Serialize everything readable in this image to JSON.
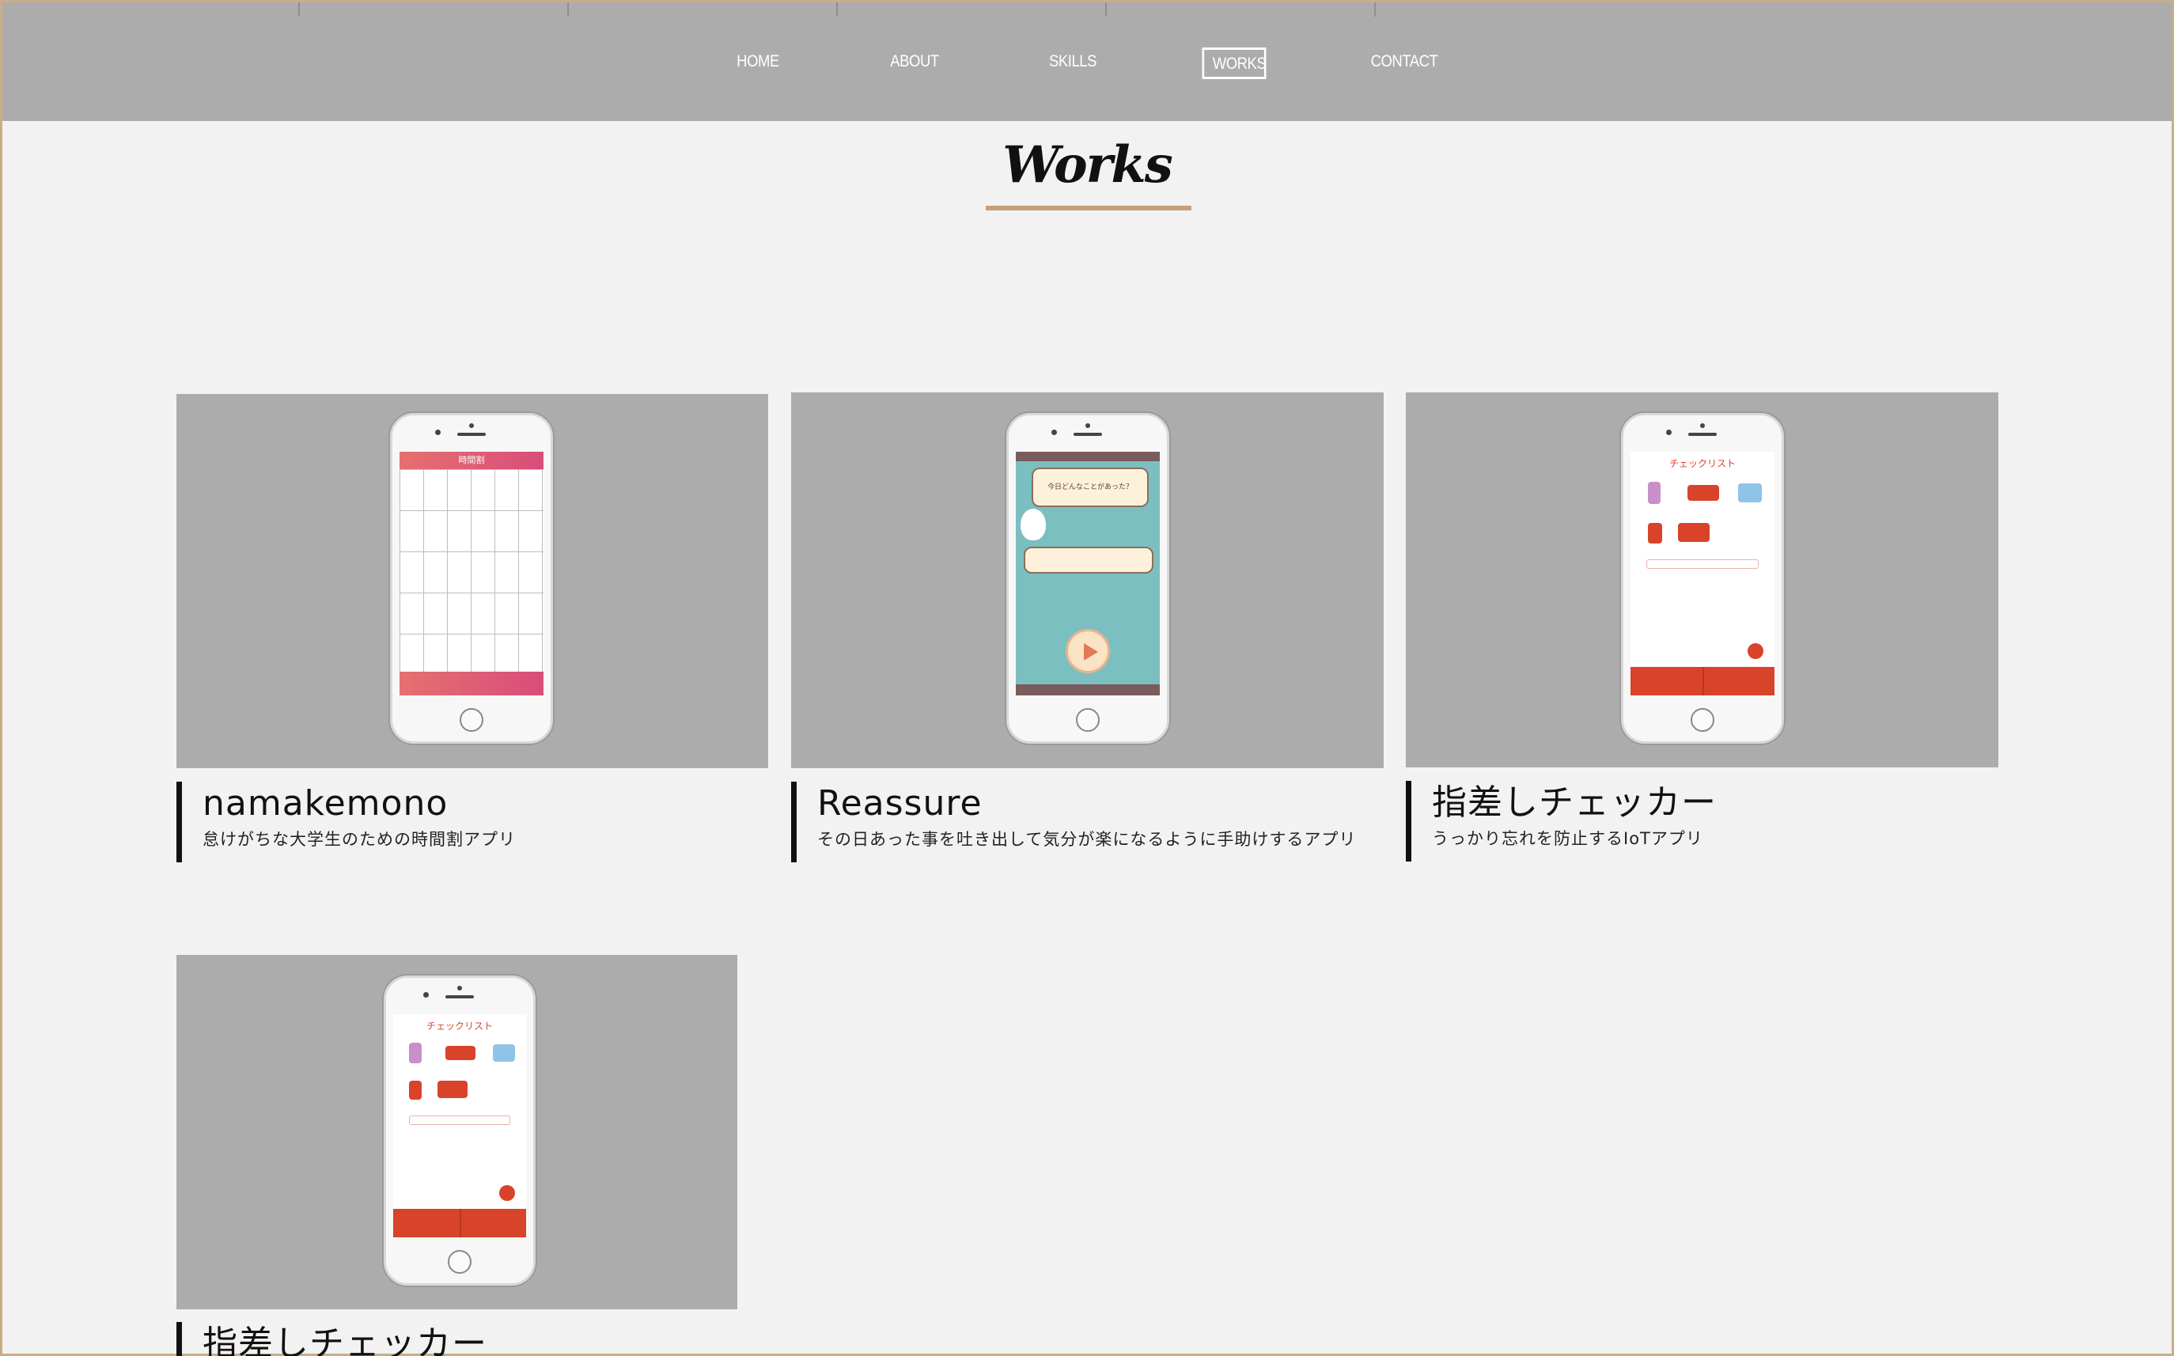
{
  "nav": {
    "items": [
      {
        "label": "HOME",
        "active": false
      },
      {
        "label": "ABOUT",
        "active": false
      },
      {
        "label": "SKILLS",
        "active": false
      },
      {
        "label": "WORKS",
        "active": true
      },
      {
        "label": "CONTACT",
        "active": false
      }
    ]
  },
  "section": {
    "title": "Works"
  },
  "works": [
    {
      "name": "namakemono",
      "desc": "怠けがちな大学生のための時間割アプリ",
      "screen_title": "時間割"
    },
    {
      "name": "Reassure",
      "desc": "その日あった事を吐き出して気分が楽になるように手助けするアプリ",
      "bubble_text": "今日どんなことがあった？"
    },
    {
      "name": "指差しチェッカー",
      "desc": "うっかり忘れを防止するIoTアプリ",
      "screen_title": "チェックリスト"
    },
    {
      "name": "指差しチェッカー",
      "desc": "",
      "screen_title": "チェックリスト"
    }
  ],
  "colors": {
    "nav_bg": "#acacac",
    "page_bg": "#f2f2f2",
    "accent": "#c4a07a",
    "checker_red": "#d8432a",
    "reassure_teal": "#7bbfc0"
  }
}
